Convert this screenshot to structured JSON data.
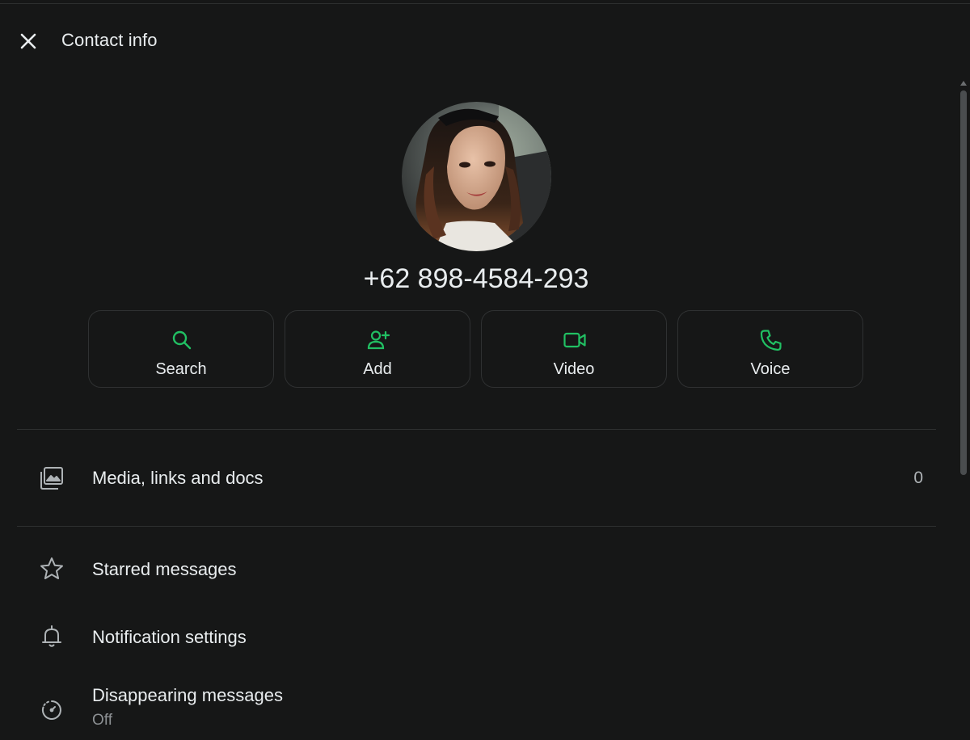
{
  "header": {
    "title": "Contact info",
    "close_icon": "close-icon"
  },
  "contact": {
    "phone": "+62 898-4584-293",
    "avatar": "profile-photo"
  },
  "actions": [
    {
      "label": "Search",
      "icon": "search-icon"
    },
    {
      "label": "Add",
      "icon": "add-person-icon"
    },
    {
      "label": "Video",
      "icon": "video-camera-icon"
    },
    {
      "label": "Voice",
      "icon": "phone-icon"
    }
  ],
  "media": {
    "label": "Media, links and docs",
    "count": "0",
    "icon": "media-gallery-icon"
  },
  "menu": {
    "starred": {
      "label": "Starred messages",
      "icon": "star-icon"
    },
    "notifications": {
      "label": "Notification settings",
      "icon": "bell-icon"
    },
    "disappearing": {
      "label": "Disappearing messages",
      "value": "Off",
      "icon": "timer-icon"
    }
  },
  "colors": {
    "background": "#161717",
    "accent": "#21c063",
    "text": "#e9edef",
    "muted": "#8d9194",
    "divider": "#2e3030"
  }
}
